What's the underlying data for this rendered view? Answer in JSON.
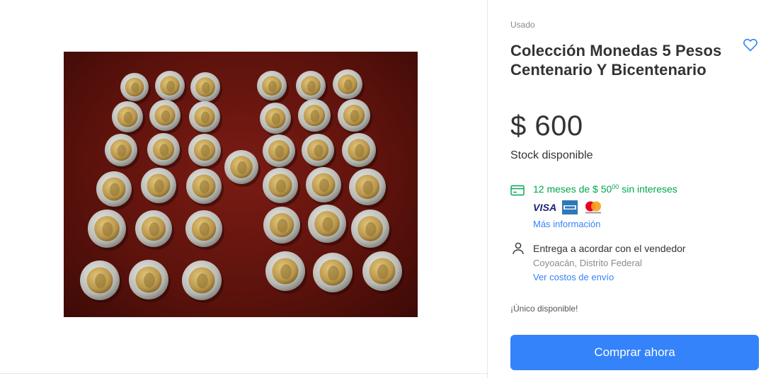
{
  "product": {
    "condition": "Usado",
    "title": "Colección Monedas 5 Pesos Centenario Y Bicentenario",
    "price": "$ 600",
    "stock": "Stock disponible"
  },
  "installments": {
    "text_prefix": "12 meses de $ 50",
    "cents": "00",
    "text_suffix": " sin intereses",
    "more_info": "Más información",
    "cards": [
      "VISA",
      "American Express",
      "mastercard"
    ]
  },
  "shipping": {
    "title": "Entrega a acordar con el vendedor",
    "location": "Coyoacán, Distrito Federal",
    "costs_link": "Ver costos de envío"
  },
  "availability": "¡Único disponible!",
  "buy_button": "Comprar ahora",
  "icons": [
    "heart-icon",
    "credit-card-icon",
    "person-icon"
  ],
  "colors": {
    "accent": "#3483fa",
    "installments_green": "#00a650",
    "photo_background": "#6b160f"
  }
}
